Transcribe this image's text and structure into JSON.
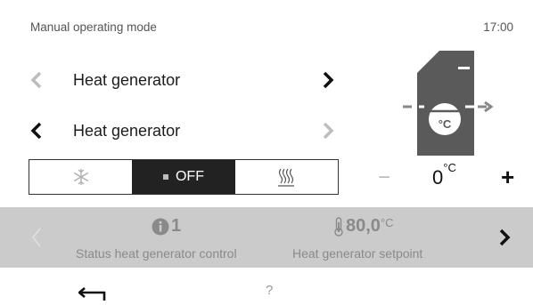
{
  "header": {
    "title": "Manual operating mode",
    "time": "17:00"
  },
  "rows": [
    {
      "label": "Heat generator",
      "prev_enabled": false,
      "next_enabled": true
    },
    {
      "label": "Heat generator",
      "prev_enabled": true,
      "next_enabled": false
    }
  ],
  "modes": {
    "options": [
      {
        "name": "frost-protection",
        "icon": "snowflake-icon",
        "label": ""
      },
      {
        "name": "off",
        "icon": "square-icon",
        "label": "OFF",
        "selected": true
      },
      {
        "name": "heating",
        "icon": "heat-waves-icon",
        "label": ""
      }
    ]
  },
  "setpoint": {
    "value": "0",
    "unit": "°C",
    "minus": "−",
    "plus": "+"
  },
  "device_icon": {
    "icon": "boiler-icon",
    "label": "°C"
  },
  "status": {
    "items": [
      {
        "icon": "info-icon",
        "value": "1",
        "unit": "",
        "label": "Status heat generator control"
      },
      {
        "icon": "thermometer-icon",
        "value": "80,0",
        "unit": "°C",
        "label": "Heat generator setpoint"
      }
    ]
  },
  "footer": {
    "help": "?"
  },
  "colors": {
    "active_mode_bg": "#222222",
    "status_bar_bg": "#cbcbcb",
    "muted_text": "#8a8a8a",
    "device_grey": "#5a5a5a"
  }
}
